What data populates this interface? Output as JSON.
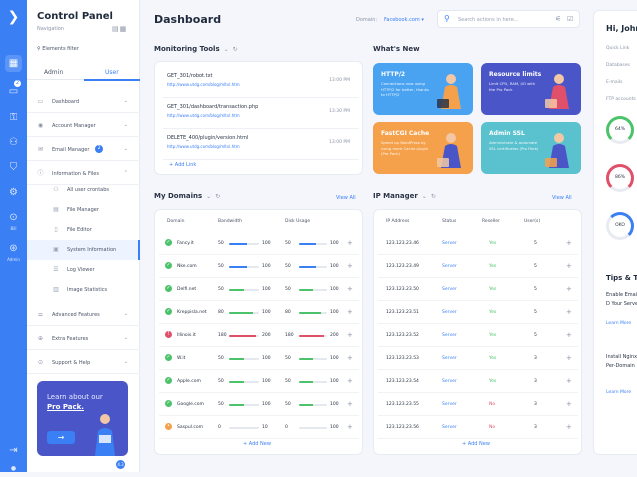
{
  "sidebar": {
    "title": "Control Panel",
    "subtitle": "Navigation",
    "filter_label": "Elements filter",
    "tabs": [
      "Admin",
      "User"
    ],
    "nav": [
      {
        "label": "Dashboard",
        "icon": "monitor-icon"
      },
      {
        "label": "Account Manager",
        "icon": "user-icon"
      },
      {
        "label": "Email Manager",
        "icon": "mail-icon",
        "badge": "2"
      },
      {
        "label": "Information & Files",
        "icon": "info-icon"
      }
    ],
    "sub": [
      {
        "label": "All user crontabs",
        "icon": "people-icon"
      },
      {
        "label": "File Manager",
        "icon": "folder-icon"
      },
      {
        "label": "File Editor",
        "icon": "file-icon"
      },
      {
        "label": "System Information",
        "icon": "chip-icon"
      },
      {
        "label": "Log Viewer",
        "icon": "log-icon"
      },
      {
        "label": "Image Statistics",
        "icon": "stats-icon"
      }
    ],
    "nav2": [
      {
        "label": "Advanced Features",
        "icon": "sliders-icon"
      },
      {
        "label": "Extra Features",
        "icon": "plus-icon"
      },
      {
        "label": "Support & Help",
        "icon": "help-icon"
      }
    ],
    "promo": {
      "line1": "Learn about our",
      "line2": "Pro Pack."
    },
    "version": "4.3"
  },
  "rail": {
    "badge": "2",
    "labels": [
      "Bill",
      "Admin"
    ]
  },
  "header": {
    "title": "Dashboard",
    "domain_label": "Domain:",
    "domain_value": "Facebook.com",
    "search_placeholder": "Search actions in here..."
  },
  "monitoring": {
    "title": "Monitoring Tools",
    "items": [
      {
        "name": "GET_301/robot.txt",
        "url": "http://www.utdg.com/blog/mltvl.htm",
        "time": "13:00 PM"
      },
      {
        "name": "GET_301/dashboard/transaction.php",
        "url": "http://www.utdg.com/blog/mltvl.htm",
        "time": "13:30 PM"
      },
      {
        "name": "DELETE_400/plugin/version.html",
        "url": "http://www.utdg.com/blog/mltvl.htm",
        "time": "13:00 PM"
      }
    ],
    "add_link": "Add Link"
  },
  "whatsnew": {
    "title": "What's New",
    "cards": [
      {
        "title": "HTTP/2",
        "desc": "Connections now using HTTP/2 for better, thanks to HTTP/2",
        "color": "#4aa3f0"
      },
      {
        "title": "Resource limits",
        "desc": "Limit CPU, RAM, I/O with the Pro Pack",
        "color": "#4a56c8"
      },
      {
        "title": "FastCGI Cache",
        "desc": "Speed up WordPress by using more Cache plugin (Pro Pack)",
        "color": "#f5a04a"
      },
      {
        "title": "Admin SSL",
        "desc": "Administrate & automate SSL certificates (Pro Pack)",
        "color": "#5ac1cf"
      }
    ]
  },
  "domains": {
    "title": "My Domains",
    "view_all": "View All",
    "headers": [
      "Domain",
      "Bandwidth",
      "Disk Usage"
    ],
    "rows": [
      {
        "name": "Fancy.it",
        "status": "ok",
        "bw_used": "50",
        "bw_max": "100",
        "bw_pct": 0.6,
        "disk_used": "50",
        "disk_max": "100",
        "disk_pct": 0.6
      },
      {
        "name": "Nke.com",
        "status": "ok",
        "bw_used": "50",
        "bw_max": "100",
        "bw_pct": 0.6,
        "disk_used": "50",
        "disk_max": "100",
        "disk_pct": 0.6
      },
      {
        "name": "Delfi.net",
        "status": "ok",
        "bw_used": "50",
        "bw_max": "100",
        "bw_pct": 0.5,
        "disk_used": "50",
        "disk_max": "100",
        "disk_pct": 0.5
      },
      {
        "name": "Kreppisla.net",
        "status": "ok",
        "bw_used": "80",
        "bw_max": "100",
        "bw_pct": 0.8,
        "disk_used": "80",
        "disk_max": "100",
        "disk_pct": 0.8
      },
      {
        "name": "Illinois.it",
        "status": "error",
        "bw_used": "180",
        "bw_max": "200",
        "bw_pct": 0.9,
        "disk_used": "180",
        "disk_max": "200",
        "disk_pct": 0.9
      },
      {
        "name": "W.it",
        "status": "ok",
        "bw_used": "50",
        "bw_max": "100",
        "bw_pct": 0.5,
        "disk_used": "50",
        "disk_max": "100",
        "disk_pct": 0.5
      },
      {
        "name": "Apple.com",
        "status": "ok",
        "bw_used": "50",
        "bw_max": "100",
        "bw_pct": 0.5,
        "disk_used": "50",
        "disk_max": "100",
        "disk_pct": 0.5
      },
      {
        "name": "Google.com",
        "status": "ok",
        "bw_used": "50",
        "bw_max": "100",
        "bw_pct": 0.5,
        "disk_used": "50",
        "disk_max": "100",
        "disk_pct": 0.5
      },
      {
        "name": "Saspul.com",
        "status": "warn",
        "bw_used": "0",
        "bw_max": "10",
        "bw_pct": 0.0,
        "disk_used": "0",
        "disk_max": "100",
        "disk_pct": 0.0
      }
    ],
    "add_new": "Add New"
  },
  "ip": {
    "title": "IP Manager",
    "view_all": "View All",
    "headers": [
      "IP Address",
      "Status",
      "Reseller",
      "User(s)"
    ],
    "rows": [
      {
        "ip": "123.123.23.46",
        "status": "Server",
        "reseller": "Yes",
        "users": "5"
      },
      {
        "ip": "123.123.23.49",
        "status": "Server",
        "reseller": "Yes",
        "users": "5"
      },
      {
        "ip": "123.123.23.50",
        "status": "Server",
        "reseller": "Yes",
        "users": "5"
      },
      {
        "ip": "123.123.23.51",
        "status": "Server",
        "reseller": "Yes",
        "users": "5"
      },
      {
        "ip": "123.123.23.52",
        "status": "Server",
        "reseller": "Yes",
        "users": "5"
      },
      {
        "ip": "123.123.23.53",
        "status": "Server",
        "reseller": "Yes",
        "users": "3"
      },
      {
        "ip": "123.123.23.54",
        "status": "Server",
        "reseller": "Yes",
        "users": "3"
      },
      {
        "ip": "123.123.23.55",
        "status": "Server",
        "reseller": "No",
        "users": "3"
      },
      {
        "ip": "123.123.23.56",
        "status": "Server",
        "reseller": "No",
        "users": "3"
      }
    ],
    "add_new": "Add New"
  },
  "right": {
    "greeting": "Hi, John D",
    "quick": [
      "Quick Link",
      "Databases",
      "E-mails",
      "FTP accounts"
    ],
    "rings": [
      {
        "label": "64%",
        "pct": 0.64,
        "color": "#4cc36a"
      },
      {
        "label": "86%",
        "pct": 0.86,
        "color": "#e0506a"
      },
      {
        "label": "OKO",
        "pct": 0.5,
        "color": "#3b7ff5"
      }
    ],
    "tips_title": "Tips & Tricks",
    "tips": [
      {
        "text": "Enable Email and Save D Your Server",
        "more": "Learn More"
      },
      {
        "text": "Install Nginx Proxy and Per-Domain",
        "more": "Learn More"
      }
    ]
  }
}
